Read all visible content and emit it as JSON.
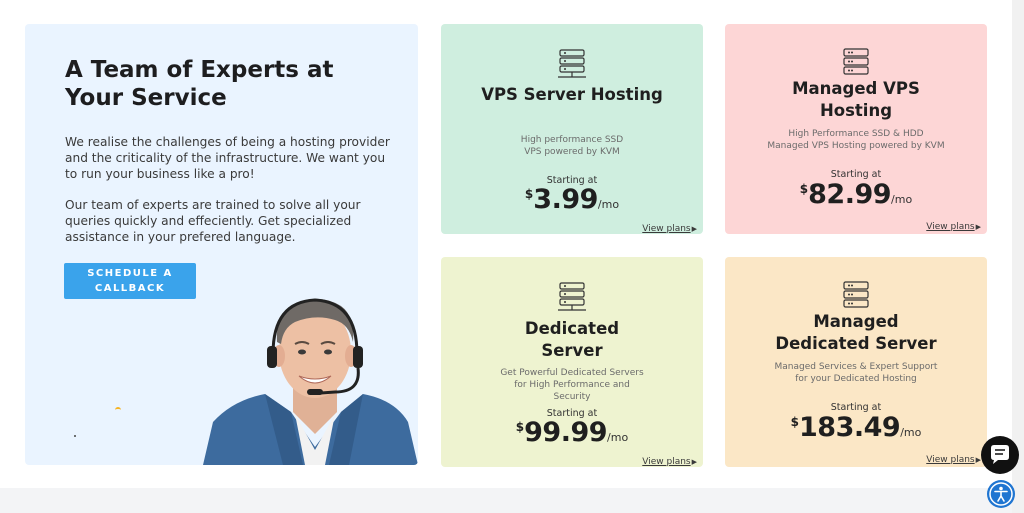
{
  "hero": {
    "title": "A Team of Experts at Your Service",
    "paragraph1": "We realise the challenges of being a hosting provider and the criticality of the infrastructure. We want you to run your business like a pro!",
    "paragraph2": "Our team of experts are trained to solve all your queries quickly and effeciently. Get specialized assistance in your prefered language.",
    "cta_line1": "SCHEDULE A",
    "cta_line2": "CALLBACK",
    "cta_color": "#3aa3eb",
    "background": "#eaf4ff",
    "image_icon": "support-agent-photo"
  },
  "cards": [
    {
      "title": "VPS Server Hosting",
      "description": "High performance SSD VPS powered by KVM",
      "starting_label": "Starting at",
      "currency": "$",
      "price": "3.99",
      "period": "/mo",
      "link": "View plans",
      "icon": "server-icon",
      "color": "#cfeedf"
    },
    {
      "title": "Managed VPS Hosting",
      "description": "High Performance SSD & HDD Managed VPS Hosting powered by KVM",
      "starting_label": "Starting at",
      "currency": "$",
      "price": "82.99",
      "period": "/mo",
      "link": "View plans",
      "icon": "server-stack-icon",
      "color": "#fdd6d6"
    },
    {
      "title": "Dedicated Server",
      "description": "Get Powerful Dedicated Servers for High Performance and Security",
      "starting_label": "Starting at",
      "currency": "$",
      "price": "99.99",
      "period": "/mo",
      "link": "View plans",
      "icon": "server-icon",
      "color": "#eef3d0"
    },
    {
      "title": "Managed Dedicated Server",
      "description": "Managed Services & Expert Support for your Dedicated Hosting",
      "starting_label": "Starting at",
      "currency": "$",
      "price": "183.49",
      "period": "/mo",
      "link": "View plans",
      "icon": "server-stack-icon",
      "color": "#fbe7c6"
    }
  ],
  "floating": {
    "chat_icon": "chat-bubble-icon",
    "accessibility_icon": "accessibility-icon"
  }
}
